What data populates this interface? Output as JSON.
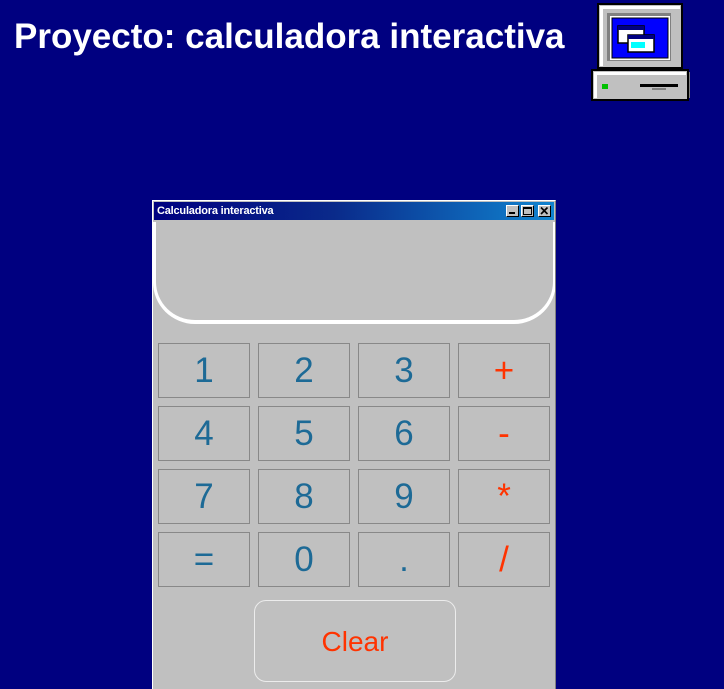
{
  "page": {
    "title": "Proyecto: calculadora interactiva"
  },
  "window": {
    "title": "Calculadora interactiva",
    "controls": [
      "minimize-icon",
      "maximize-icon",
      "close-icon"
    ]
  },
  "display": {
    "value": ""
  },
  "keypad": {
    "rows": [
      [
        {
          "label": "1",
          "kind": "digit"
        },
        {
          "label": "2",
          "kind": "digit"
        },
        {
          "label": "3",
          "kind": "digit"
        },
        {
          "label": "+",
          "kind": "operator"
        }
      ],
      [
        {
          "label": "4",
          "kind": "digit"
        },
        {
          "label": "5",
          "kind": "digit"
        },
        {
          "label": "6",
          "kind": "digit"
        },
        {
          "label": "-",
          "kind": "operator"
        }
      ],
      [
        {
          "label": "7",
          "kind": "digit"
        },
        {
          "label": "8",
          "kind": "digit"
        },
        {
          "label": "9",
          "kind": "digit"
        },
        {
          "label": "*",
          "kind": "operator"
        }
      ],
      [
        {
          "label": "=",
          "kind": "digit"
        },
        {
          "label": "0",
          "kind": "digit"
        },
        {
          "label": ".",
          "kind": "digit"
        },
        {
          "label": "/",
          "kind": "operator"
        }
      ]
    ],
    "clear_label": "Clear"
  },
  "colors": {
    "background": "#000080",
    "window_face": "#c0c0c0",
    "digit_text": "#1d6a96",
    "operator_text": "#ff3300"
  }
}
